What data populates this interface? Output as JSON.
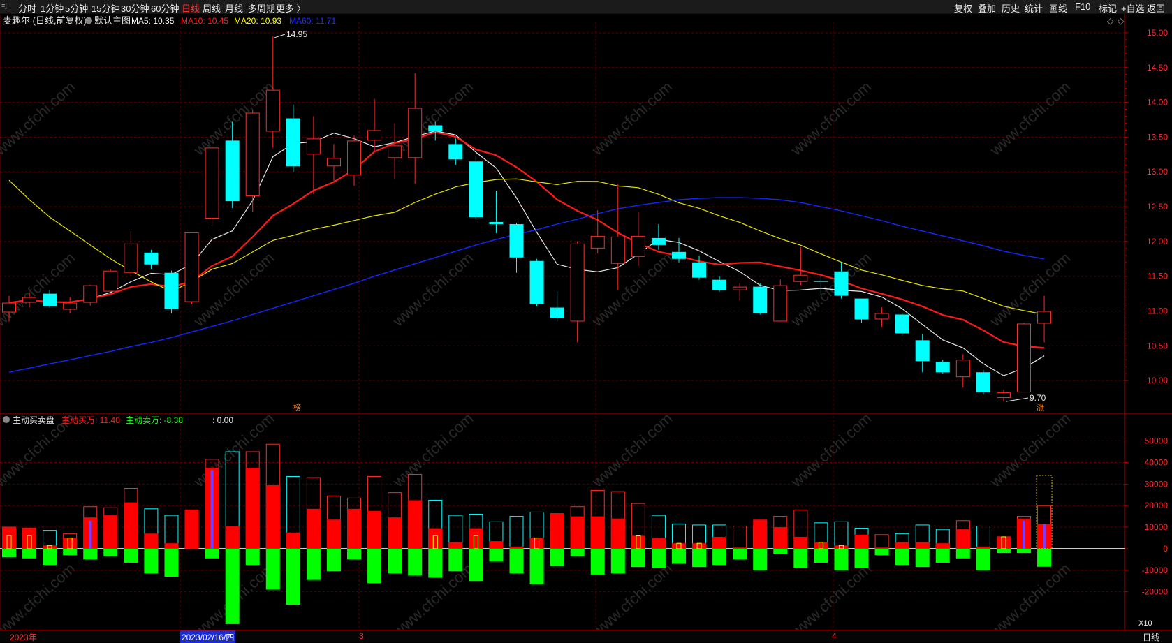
{
  "toolbar": {
    "left_items": [
      {
        "label": "分时",
        "active": false
      },
      {
        "label": "1分钟",
        "active": false
      },
      {
        "label": "5分钟",
        "active": false
      },
      {
        "label": "15分钟",
        "active": false
      },
      {
        "label": "30分钟",
        "active": false
      },
      {
        "label": "60分钟",
        "active": false
      },
      {
        "label": "日线",
        "active": true
      },
      {
        "label": "周线",
        "active": false
      },
      {
        "label": "月线",
        "active": false
      },
      {
        "label": "多周期",
        "active": false
      },
      {
        "label": "更多 〉",
        "active": false
      }
    ],
    "right_items": [
      "复权",
      "叠加",
      "历史",
      "统计",
      "画线",
      "F10",
      "标记",
      "+自选",
      "返回"
    ]
  },
  "main_panel": {
    "title": "麦趣尔 (日线,前复权)",
    "main_chart_label": "默认主图",
    "ma_labels": [
      {
        "text": "MA5: 10.35",
        "color": "#ffffff"
      },
      {
        "text": "MA10: 10.45",
        "color": "#ff2020"
      },
      {
        "text": "MA20: 10.93",
        "color": "#ffff00"
      },
      {
        "text": "MA60: 11.71",
        "color": "#2030ff"
      }
    ],
    "high_label": "14.95",
    "low_label": "9.70",
    "bang_marker": "榜",
    "zhang_marker": "涨",
    "price_axis": [
      "15.00",
      "14.50",
      "14.00",
      "13.50",
      "13.00",
      "12.50",
      "12.00",
      "11.50",
      "11.00",
      "10.50",
      "10.00"
    ]
  },
  "sub_panel": {
    "title": "主动买卖盘",
    "buy_label": "主动买万: 11.40",
    "sell_label": "主动卖万: -8.38",
    "zero_label": ": 0.00",
    "axis": [
      "50000",
      "40000",
      "30000",
      "20000",
      "10000",
      "0",
      "-10000",
      "-20000"
    ],
    "unit": "X10"
  },
  "bottom_bar": {
    "year_label": "2023年",
    "cursor_date": "2023/02/16/四",
    "month_3": "3",
    "month_4": "4",
    "period": "日线"
  },
  "watermark": "www.cfchi.com",
  "colors": {
    "up": "#ff2a2a",
    "down": "#00ffff",
    "ma5": "#e8e8e8",
    "ma10": "#ff1a1a",
    "ma20": "#e6e600",
    "ma60": "#1428ff",
    "buy": "#ff0000",
    "sell": "#00ff00"
  },
  "chart_data": {
    "type": "candlestick",
    "price_range": [
      9.55,
      15.15
    ],
    "volume_range": [
      -36000,
      57000
    ],
    "candles": [
      {
        "o": 10.98,
        "h": 11.22,
        "l": 10.85,
        "c": 11.12
      },
      {
        "o": 11.12,
        "h": 11.27,
        "l": 11.05,
        "c": 11.2
      },
      {
        "o": 11.25,
        "h": 11.3,
        "l": 11.05,
        "c": 11.07
      },
      {
        "o": 11.02,
        "h": 11.2,
        "l": 10.97,
        "c": 11.12
      },
      {
        "o": 11.12,
        "h": 11.38,
        "l": 11.08,
        "c": 11.37
      },
      {
        "o": 11.28,
        "h": 11.6,
        "l": 11.28,
        "c": 11.58
      },
      {
        "o": 11.55,
        "h": 12.15,
        "l": 11.5,
        "c": 11.97
      },
      {
        "o": 11.84,
        "h": 11.88,
        "l": 11.6,
        "c": 11.67
      },
      {
        "o": 11.55,
        "h": 11.58,
        "l": 10.97,
        "c": 11.03
      },
      {
        "o": 11.13,
        "h": 12.13,
        "l": 11.1,
        "c": 12.13
      },
      {
        "o": 12.33,
        "h": 13.38,
        "l": 12.22,
        "c": 13.35
      },
      {
        "o": 13.45,
        "h": 13.72,
        "l": 12.48,
        "c": 12.58
      },
      {
        "o": 12.65,
        "h": 13.9,
        "l": 12.42,
        "c": 13.85
      },
      {
        "o": 13.58,
        "h": 14.95,
        "l": 13.35,
        "c": 14.18
      },
      {
        "o": 13.77,
        "h": 13.97,
        "l": 13.0,
        "c": 13.08
      },
      {
        "o": 13.25,
        "h": 13.8,
        "l": 12.68,
        "c": 13.48
      },
      {
        "o": 13.08,
        "h": 13.4,
        "l": 12.87,
        "c": 13.2
      },
      {
        "o": 12.95,
        "h": 13.52,
        "l": 12.8,
        "c": 13.45
      },
      {
        "o": 13.45,
        "h": 14.05,
        "l": 13.3,
        "c": 13.6
      },
      {
        "o": 13.2,
        "h": 13.7,
        "l": 12.9,
        "c": 13.38
      },
      {
        "o": 13.2,
        "h": 14.42,
        "l": 12.83,
        "c": 13.92
      },
      {
        "o": 13.67,
        "h": 13.72,
        "l": 13.45,
        "c": 13.58
      },
      {
        "o": 13.4,
        "h": 13.48,
        "l": 13.1,
        "c": 13.18
      },
      {
        "o": 13.15,
        "h": 13.22,
        "l": 12.33,
        "c": 12.35
      },
      {
        "o": 12.28,
        "h": 12.73,
        "l": 12.12,
        "c": 12.25
      },
      {
        "o": 12.25,
        "h": 12.27,
        "l": 11.55,
        "c": 11.77
      },
      {
        "o": 11.72,
        "h": 11.75,
        "l": 11.07,
        "c": 11.1
      },
      {
        "o": 11.05,
        "h": 11.28,
        "l": 10.85,
        "c": 10.9
      },
      {
        "o": 10.85,
        "h": 12.0,
        "l": 10.55,
        "c": 11.97
      },
      {
        "o": 11.9,
        "h": 12.45,
        "l": 11.83,
        "c": 12.08
      },
      {
        "o": 11.68,
        "h": 12.82,
        "l": 11.3,
        "c": 12.07
      },
      {
        "o": 11.78,
        "h": 12.42,
        "l": 11.65,
        "c": 12.08
      },
      {
        "o": 12.05,
        "h": 12.25,
        "l": 11.88,
        "c": 11.95
      },
      {
        "o": 11.85,
        "h": 12.05,
        "l": 11.7,
        "c": 11.75
      },
      {
        "o": 11.7,
        "h": 11.8,
        "l": 11.45,
        "c": 11.48
      },
      {
        "o": 11.45,
        "h": 11.5,
        "l": 11.28,
        "c": 11.3
      },
      {
        "o": 11.3,
        "h": 11.4,
        "l": 11.15,
        "c": 11.35
      },
      {
        "o": 11.35,
        "h": 11.4,
        "l": 10.95,
        "c": 10.97
      },
      {
        "o": 10.85,
        "h": 11.45,
        "l": 10.85,
        "c": 11.37
      },
      {
        "o": 11.42,
        "h": 11.92,
        "l": 11.37,
        "c": 11.52
      },
      {
        "o": 11.43,
        "h": 11.5,
        "l": 11.23,
        "c": 11.42
      },
      {
        "o": 11.57,
        "h": 11.7,
        "l": 11.18,
        "c": 11.22
      },
      {
        "o": 11.18,
        "h": 11.18,
        "l": 10.83,
        "c": 10.88
      },
      {
        "o": 10.88,
        "h": 11.05,
        "l": 10.77,
        "c": 10.97
      },
      {
        "o": 10.95,
        "h": 10.97,
        "l": 10.65,
        "c": 10.68
      },
      {
        "o": 10.58,
        "h": 10.67,
        "l": 10.12,
        "c": 10.28
      },
      {
        "o": 10.27,
        "h": 10.3,
        "l": 10.1,
        "c": 10.12
      },
      {
        "o": 10.05,
        "h": 10.38,
        "l": 9.9,
        "c": 10.3
      },
      {
        "o": 10.12,
        "h": 10.15,
        "l": 9.8,
        "c": 9.83
      },
      {
        "o": 9.75,
        "h": 9.87,
        "l": 9.7,
        "c": 9.83
      },
      {
        "o": 9.83,
        "h": 10.83,
        "l": 9.83,
        "c": 10.82
      },
      {
        "o": 10.82,
        "h": 11.22,
        "l": 10.55,
        "c": 11.0
      }
    ],
    "ma20_prefix": [
      12.88,
      12.6,
      12.35,
      12.15,
      11.95,
      11.75,
      11.58,
      11.42,
      11.28
    ],
    "ma60_prefix": [
      10.12,
      10.18,
      10.24,
      10.3,
      10.36,
      10.42,
      10.49,
      10.55,
      10.62,
      10.7,
      10.78,
      10.86,
      10.95,
      11.04,
      11.13,
      11.22,
      11.31,
      11.4,
      11.5,
      11.59,
      11.68,
      11.77,
      11.86,
      11.95,
      12.03,
      12.1,
      12.17,
      12.25,
      12.32,
      12.4,
      12.47,
      12.52,
      12.56
    ],
    "buy_volume": [
      10000,
      9500,
      1500,
      5000,
      14500,
      15500,
      21500,
      7000,
      2500,
      18000,
      37500,
      10500,
      37500,
      29500,
      7500,
      18500,
      13500,
      18500,
      17500,
      14500,
      22500,
      9500,
      3000,
      9500,
      3500,
      1000,
      5000,
      16500,
      15000,
      15000,
      14000,
      6000,
      5000,
      2500,
      2500,
      5500,
      500,
      13500,
      10000,
      5500,
      3000,
      1500,
      6500,
      500,
      3000,
      3000,
      2500,
      9000,
      1000,
      5500,
      14000,
      11400
    ],
    "sell_volume": [
      -4000,
      -4500,
      -7500,
      -3000,
      -5000,
      -3500,
      -6500,
      -11500,
      -13000,
      0,
      -4500,
      -35000,
      -7500,
      -19000,
      -26000,
      -14500,
      -10500,
      -5000,
      -16000,
      -11500,
      -12500,
      -13500,
      -10500,
      -15000,
      -6000,
      -11500,
      -16500,
      -8000,
      -3500,
      -12000,
      -11500,
      -8500,
      -9000,
      -7000,
      -8500,
      -7500,
      -5000,
      -10000,
      -2500,
      -9000,
      -6500,
      -10000,
      -9000,
      -3000,
      -7500,
      -8500,
      -6500,
      -4500,
      -10000,
      -2000,
      -2000,
      -8380
    ],
    "total_volume": [
      10000,
      9500,
      8500,
      7000,
      19500,
      19000,
      28000,
      18500,
      15500,
      18000,
      41500,
      45000,
      45000,
      48500,
      33500,
      33000,
      24500,
      23500,
      33500,
      26000,
      34500,
      22500,
      15500,
      16000,
      12500,
      15000,
      17000,
      12500,
      19500,
      27000,
      26500,
      21000,
      15500,
      11500,
      11000,
      11000,
      10500,
      10000,
      15000,
      18000,
      12000,
      12500,
      9500,
      6500,
      7000,
      11000,
      9000,
      13000,
      10500,
      5500,
      15000,
      20000
    ]
  }
}
